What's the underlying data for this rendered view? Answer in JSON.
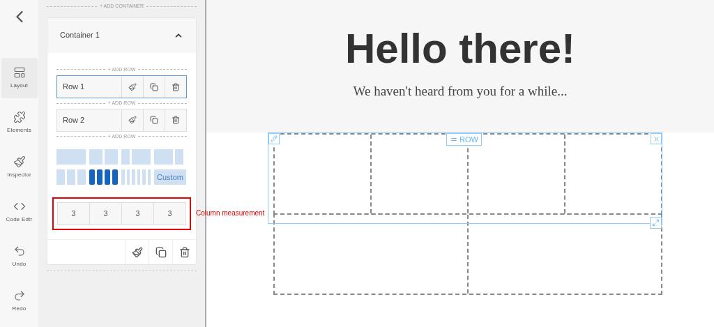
{
  "rail": {
    "items": [
      {
        "label": "Layout",
        "selected": true
      },
      {
        "label": "Elements",
        "selected": false
      },
      {
        "label": "Inspector",
        "selected": false
      },
      {
        "label": "Code Edtr",
        "selected": false
      },
      {
        "label": "Undo",
        "selected": false
      },
      {
        "label": "Redo",
        "selected": false
      }
    ]
  },
  "sidebar": {
    "add_container": "+ ADD CONTAINER",
    "container": {
      "title": "Container 1",
      "expanded": true,
      "add_row_labels": [
        "+ ADD ROW",
        "+ ADD ROW",
        "+ ADD ROW"
      ],
      "rows": [
        {
          "name": "Row 1",
          "selected": true
        },
        {
          "name": "Row 2",
          "selected": false
        }
      ],
      "layouts": [
        {
          "kind": "full",
          "selected": false
        },
        {
          "kind": "halves",
          "selected": false
        },
        {
          "kind": "narrow-wide",
          "selected": false
        },
        {
          "kind": "wide-narrow",
          "selected": false
        },
        {
          "kind": "thirds",
          "selected": false
        },
        {
          "kind": "quarters",
          "selected": true
        },
        {
          "kind": "sixths",
          "selected": false
        },
        {
          "kind": "custom",
          "label": "Custom",
          "selected": false
        }
      ],
      "measurements": [
        "3",
        "3",
        "3",
        "3"
      ],
      "annotation": "Column measurement"
    }
  },
  "canvas": {
    "title": "Hello there!",
    "subtitle": "We haven't heard from you for a while...",
    "row_tag": "ROW",
    "grid": [
      {
        "kind": "quarters",
        "selected": true
      },
      {
        "kind": "halves",
        "selected": false
      }
    ]
  }
}
